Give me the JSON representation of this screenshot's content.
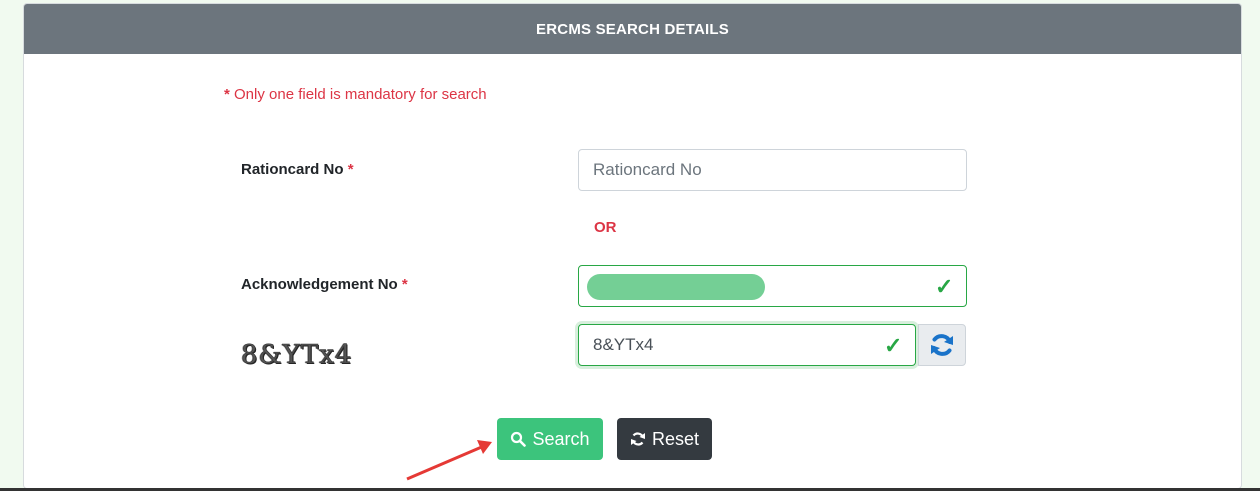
{
  "header": {
    "title": "ERCMS SEARCH DETAILS"
  },
  "note": {
    "star": "*",
    "text": "Only one field is mandatory for search"
  },
  "fields": {
    "rationcard": {
      "label": "Rationcard No",
      "required_mark": "*",
      "placeholder": "Rationcard No",
      "value": ""
    },
    "separator": "OR",
    "acknowledgement": {
      "label": "Acknowledgement No",
      "required_mark": "*",
      "value": ""
    },
    "captcha": {
      "image_text": "8&YTx4",
      "value": "8&YTx4"
    }
  },
  "buttons": {
    "search": "Search",
    "reset": "Reset"
  },
  "icons": {
    "valid": "check-icon",
    "refresh": "refresh-icon",
    "search": "search-icon",
    "reset": "reset-icon"
  },
  "colors": {
    "header_bg": "#6c757d",
    "required": "#dc3545",
    "valid": "#28a745",
    "search_button": "#3cc47c",
    "reset_button": "#343a40"
  }
}
